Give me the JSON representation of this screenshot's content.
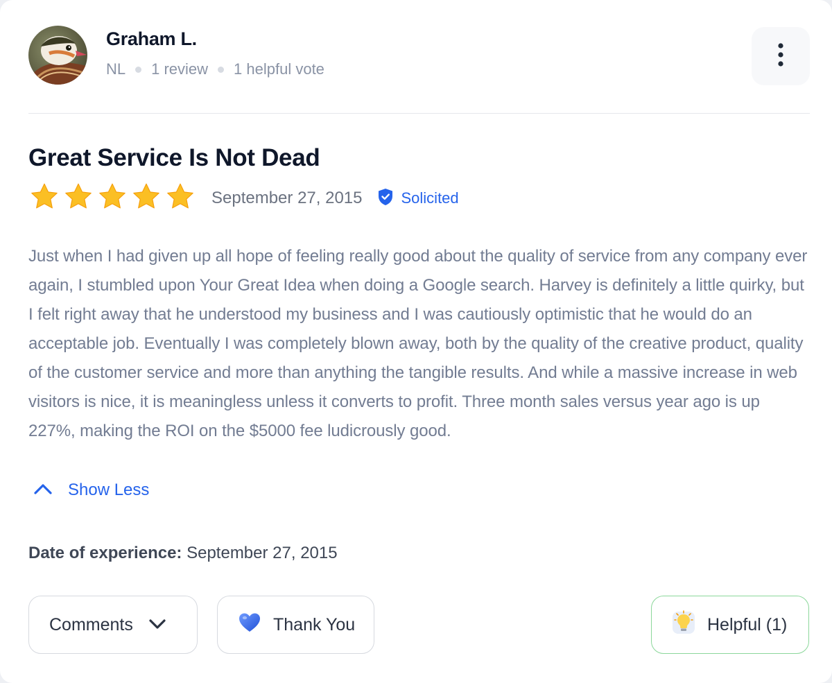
{
  "reviewer": {
    "name": "Graham L.",
    "country": "NL",
    "reviews": "1 review",
    "helpful_votes": "1 helpful vote"
  },
  "review": {
    "title": "Great Service Is Not Dead",
    "rating": 5,
    "rating_max": 5,
    "date": "September 27, 2015",
    "badge": "Solicited",
    "body": "Just when I had given up all hope of feeling really good about the quality of service from any company ever again, I stumbled upon Your Great Idea when doing a Google search. Harvey is definitely a little quirky, but I felt right away that he understood my business and I was cautiously optimistic that he would do an acceptable job. Eventually I was completely blown away, both by the quality of the creative product, quality of the customer service and more than anything the tangible results. And while a massive increase in web visitors is nice, it is meaningless unless it converts to profit. Three month sales versus year ago is up 227%, making the ROI on the $5000 fee ludicrously good.",
    "show_less_label": "Show Less",
    "experience_label": "Date of experience:",
    "experience_date": "September 27, 2015"
  },
  "actions": {
    "comments_label": "Comments",
    "thank_you_label": "Thank You",
    "helpful_label": "Helpful (1)"
  },
  "icons": {
    "more": "vertical-dots-icon",
    "star": "star-icon",
    "shield": "shield-check-icon",
    "chevron_up": "chevron-up-icon",
    "chevron_down": "chevron-down-icon",
    "heart": "heart-icon",
    "bulb": "lightbulb-icon"
  },
  "colors": {
    "accent": "#2563eb",
    "star": "#fbbf24",
    "helpful_border": "#8bd79a",
    "heart": "#3b6cf0"
  }
}
